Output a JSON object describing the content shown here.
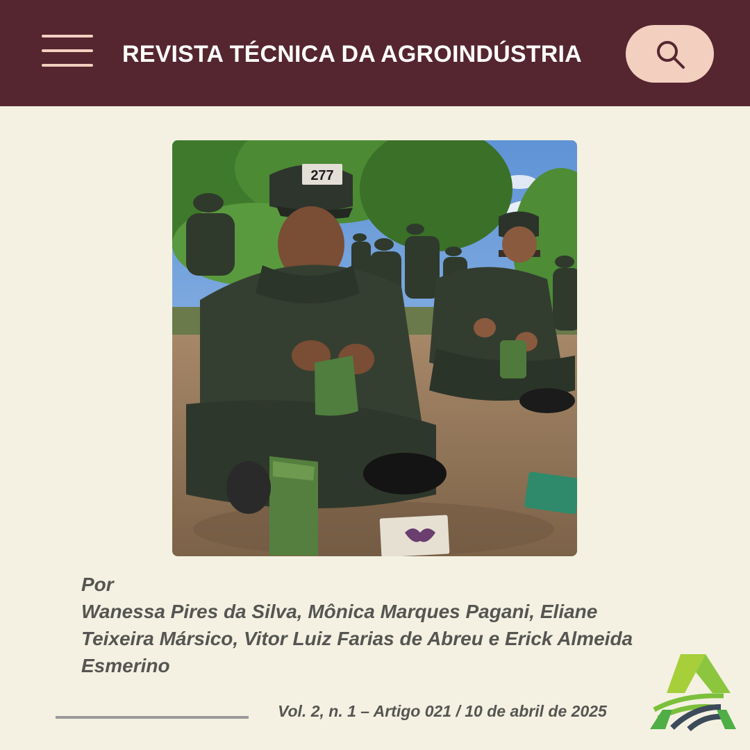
{
  "header": {
    "title": "REVISTA TÉCNICA DA AGROINDÚSTRIA",
    "menu_icon": "hamburger-menu-icon",
    "search_icon": "search-icon"
  },
  "article": {
    "photo_badge": "277",
    "byline_prefix": "Por",
    "authors_line1": "Wanessa Pires da Silva, Mônica Marques Pagani, Eliane",
    "authors_line2": "Teixeira Mársico, Vitor Luiz Farias de Abreu e Erick Almeida",
    "authors_line3": "Esmerino",
    "issue": "Vol. 2, n. 1 – Artigo 021 / 10 de abril de 2025"
  },
  "colors": {
    "header_bg": "#552630",
    "accent": "#f3cfc0",
    "page_bg": "#f4f1e2",
    "text": "#555552",
    "logo_green": "#8cc63f",
    "logo_dark": "#3c4a5a"
  }
}
